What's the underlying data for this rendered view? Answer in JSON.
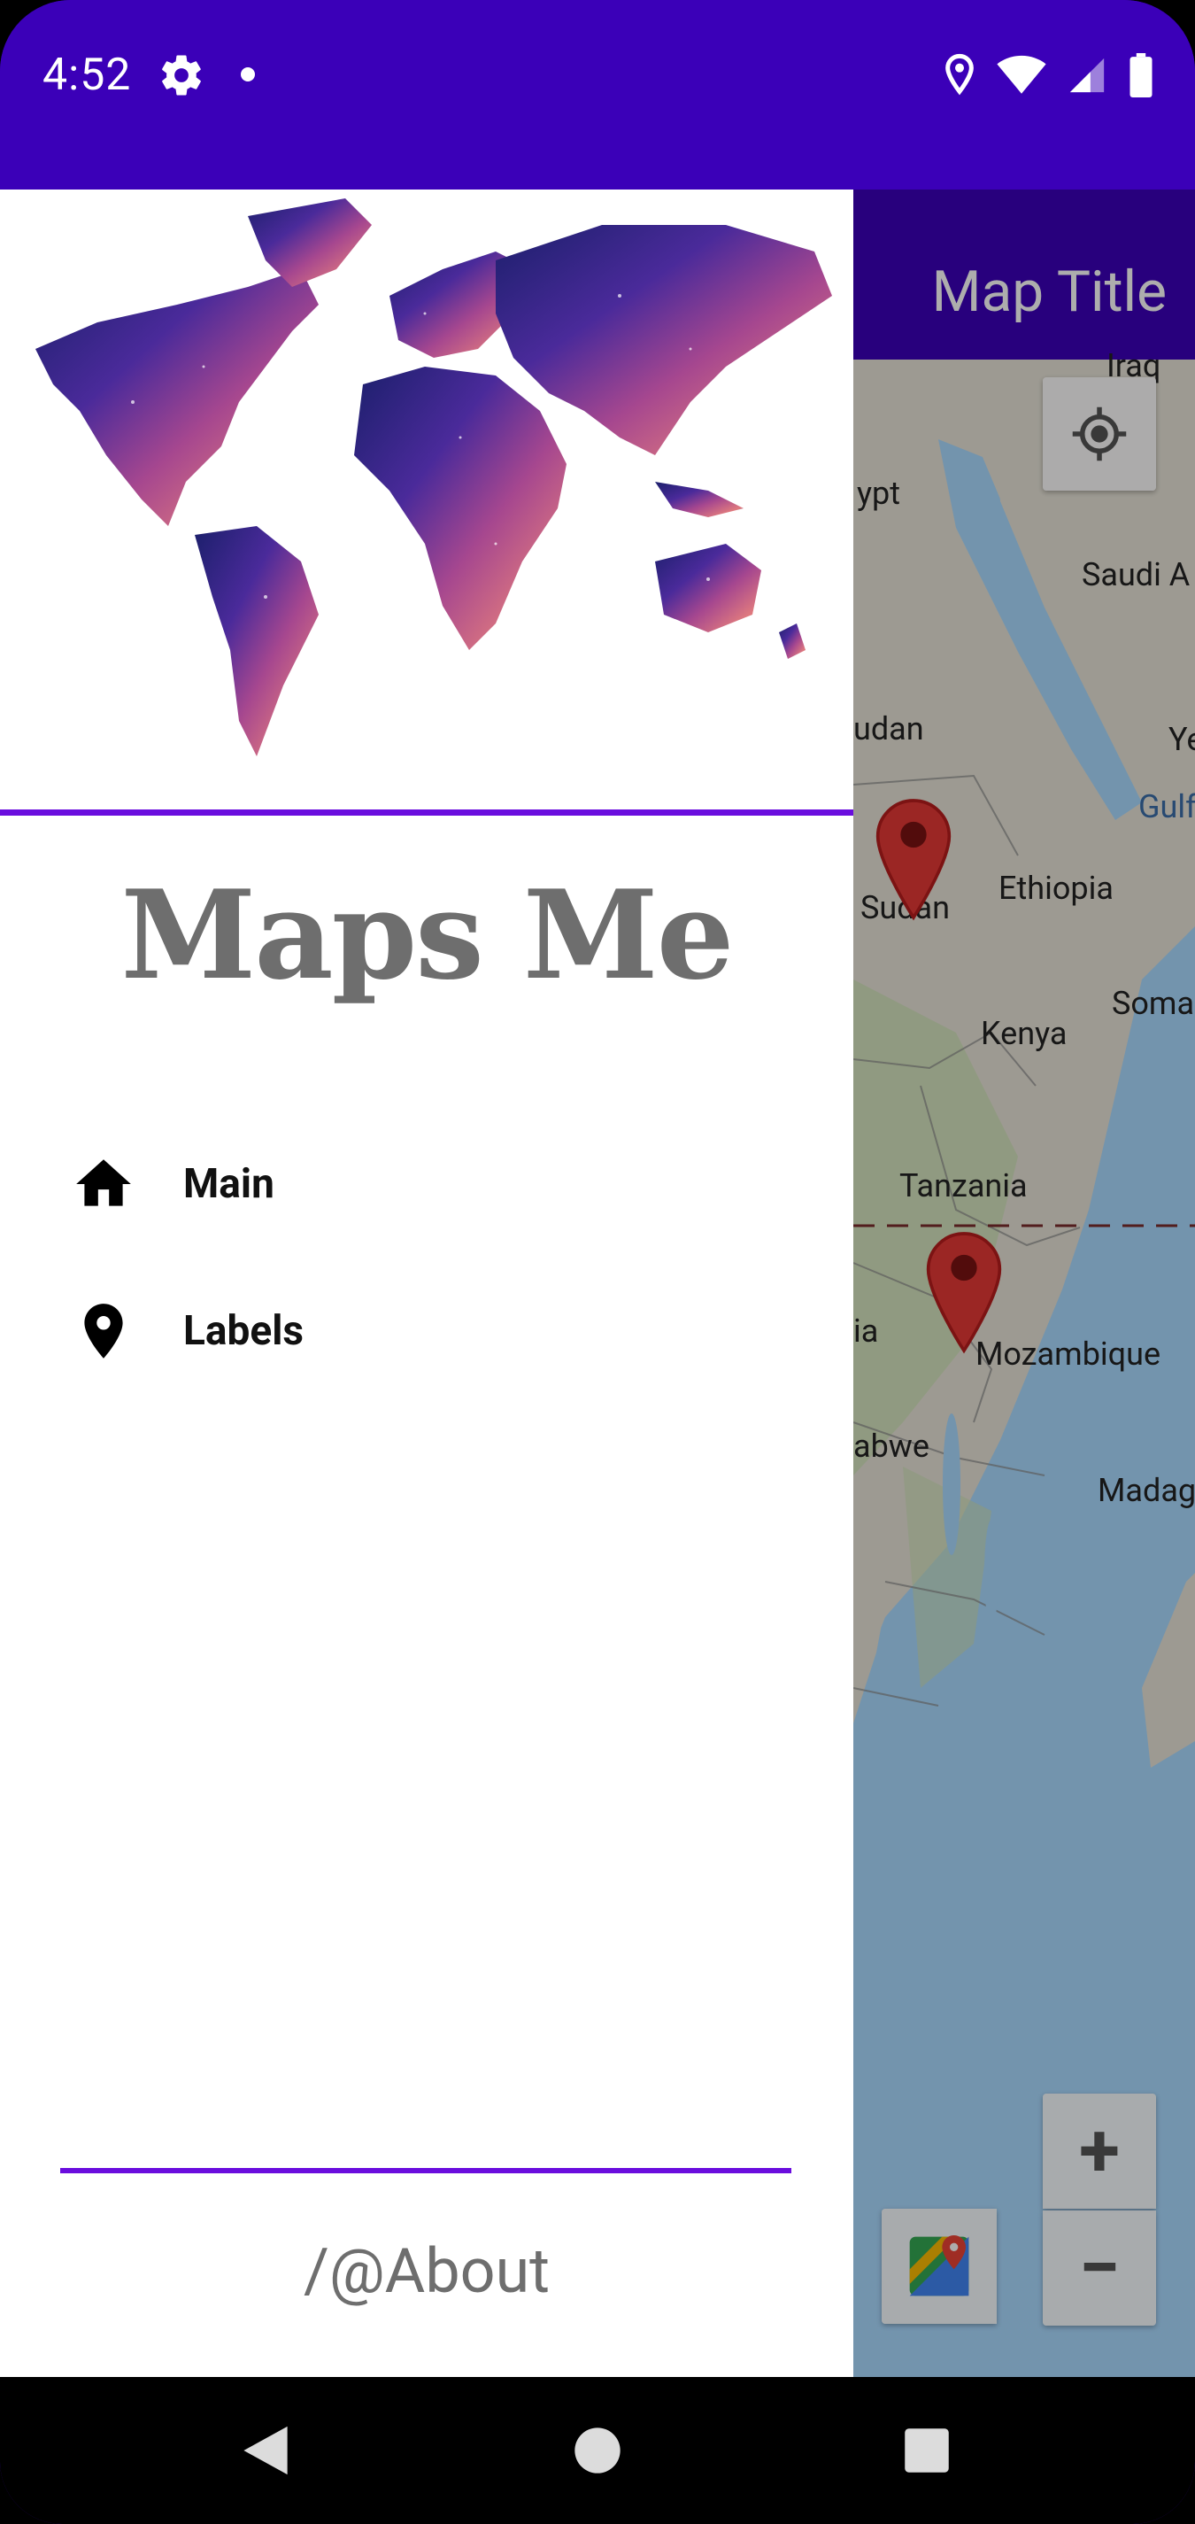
{
  "status_bar": {
    "time": "4:52",
    "icons": [
      "gear-icon",
      "notification-dot-icon",
      "location-icon",
      "wifi-icon",
      "signal-icon",
      "battery-icon"
    ],
    "background": "#3b00b8"
  },
  "map": {
    "title": "Map Title",
    "labels": [
      "Iraq",
      "ypt",
      "Saudi A",
      "udan",
      "Ye",
      "Gulf",
      "Ethiopia",
      "Sudan",
      "Soma",
      "Kenya",
      "Tanzania",
      "ia",
      "Mozambique",
      "abwe",
      "Madag"
    ],
    "zoom_in": "+",
    "zoom_out": "−",
    "icons": [
      "my-location-icon",
      "google-maps-icon",
      "map-marker-icon"
    ]
  },
  "drawer": {
    "app_name": "Maps Me",
    "accent": "#6a0dde",
    "items": [
      {
        "label": "Main",
        "icon": "home-icon"
      },
      {
        "label": "Labels",
        "icon": "location-pin-icon"
      }
    ],
    "about": "/@About"
  },
  "nav_bar": {
    "icons": [
      "back-icon",
      "home-circle-icon",
      "recents-icon"
    ]
  }
}
